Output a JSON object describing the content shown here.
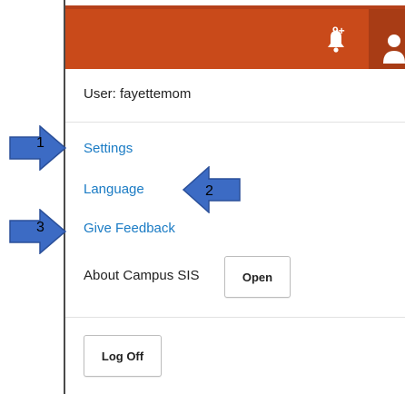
{
  "header": {
    "color": "#c94a1a",
    "notification_badge": "9+",
    "notification_icon": "bell-icon",
    "user_icon": "user-icon"
  },
  "menu": {
    "user_line": "User: fayettemom",
    "items": [
      {
        "label": "Settings"
      },
      {
        "label": "Language"
      },
      {
        "label": "Give Feedback"
      }
    ],
    "about_label": "About Campus SIS",
    "open_button": "Open",
    "logoff_button": "Log Off",
    "link_color": "#1a7bc4"
  },
  "annotations": [
    {
      "number": "1",
      "color": "#3c6bc4"
    },
    {
      "number": "2",
      "color": "#3c6bc4"
    },
    {
      "number": "3",
      "color": "#3c6bc4"
    }
  ]
}
